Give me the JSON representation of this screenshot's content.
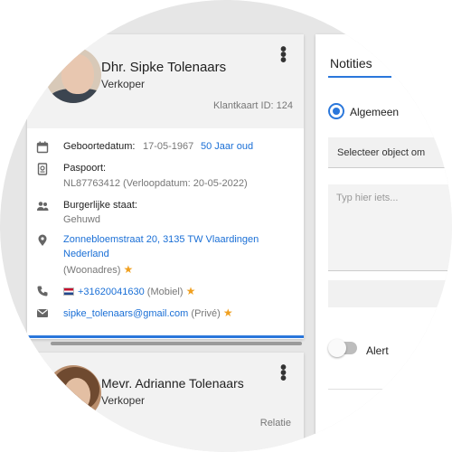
{
  "customer": {
    "name": "Dhr. Sipke Tolenaars",
    "role": "Verkoper",
    "klantkaart": "Klantkaart ID: 124",
    "birth": {
      "label": "Geboortedatum:",
      "date": "17-05-1967",
      "age": "50 Jaar oud"
    },
    "passport": {
      "label": "Paspoort:",
      "value": "NL87763412 (Verloopdatum: 20-05-2022)"
    },
    "marital": {
      "label": "Burgerlijke staat:",
      "value": "Gehuwd"
    },
    "address": {
      "line1": "Zonnebloemstraat 20, 3135 TW Vlaardingen",
      "line2": "Nederland",
      "type": "(Woonadres)"
    },
    "phone": {
      "number": "+31620041630",
      "type": "(Mobiel)"
    },
    "email": {
      "address": "sipke_tolenaars@gmail.com",
      "type": "(Privé)"
    }
  },
  "relation": {
    "name": "Mevr. Adrianne Tolenaars",
    "role": "Verkoper",
    "tag": "Relatie"
  },
  "notes": {
    "title": "Notities",
    "radio_label": "Algemeen",
    "select_placeholder": "Selecteer object om",
    "textarea_placeholder": "Typ hier iets...",
    "alert_label": "Alert",
    "alert_on": false
  },
  "icons": {
    "calendar": "calendar-icon",
    "passport": "passport-icon",
    "people": "people-icon",
    "location": "location-pin-icon",
    "phone": "phone-icon",
    "mail": "mail-icon",
    "star": "★",
    "dots": "⋮"
  },
  "colors": {
    "accent": "#2a77db",
    "link": "#1a6fd6",
    "star": "#f0a020"
  }
}
